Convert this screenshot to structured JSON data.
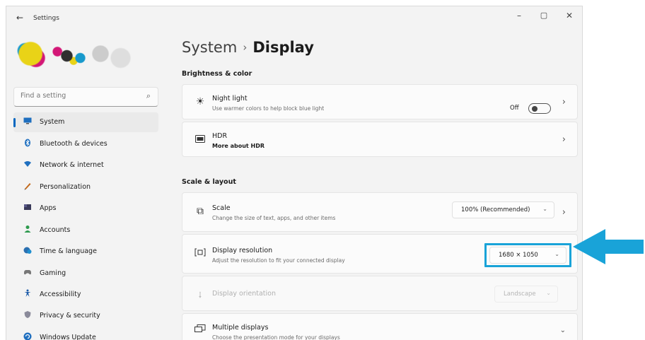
{
  "window": {
    "title": "Settings",
    "back": "←",
    "minimize": "–",
    "maximize": "▢",
    "close": "✕"
  },
  "sidebar": {
    "search": {
      "placeholder": "Find a setting",
      "icon": "search-icon"
    },
    "items": [
      {
        "label": "System",
        "icon": "monitor-icon",
        "selected": true
      },
      {
        "label": "Bluetooth & devices",
        "icon": "bluetooth-icon"
      },
      {
        "label": "Network & internet",
        "icon": "wifi-icon"
      },
      {
        "label": "Personalization",
        "icon": "pen-icon"
      },
      {
        "label": "Apps",
        "icon": "apps-icon"
      },
      {
        "label": "Accounts",
        "icon": "person-icon"
      },
      {
        "label": "Time & language",
        "icon": "globe-clock-icon"
      },
      {
        "label": "Gaming",
        "icon": "gamepad-icon"
      },
      {
        "label": "Accessibility",
        "icon": "accessibility-icon"
      },
      {
        "label": "Privacy & security",
        "icon": "shield-icon"
      },
      {
        "label": "Windows Update",
        "icon": "update-icon"
      }
    ]
  },
  "main": {
    "breadcrumb": {
      "parent": "System",
      "separator": "›",
      "current": "Display"
    },
    "sections": {
      "brightness": "Brightness & color",
      "scale_layout": "Scale & layout"
    },
    "night_light": {
      "title": "Night light",
      "description": "Use warmer colors to help block blue light",
      "state": "Off",
      "on": false
    },
    "hdr": {
      "title": "HDR",
      "link": "More about HDR"
    },
    "scale": {
      "title": "Scale",
      "description": "Change the size of text, apps, and other items",
      "value": "100% (Recommended)"
    },
    "resolution": {
      "title": "Display resolution",
      "description": "Adjust the resolution to fit your connected display",
      "value": "1680 × 1050"
    },
    "orientation": {
      "title": "Display orientation",
      "value": "Landscape"
    },
    "multiple_displays": {
      "title": "Multiple displays",
      "description": "Choose the presentation mode for your displays"
    }
  },
  "colors": {
    "accent": "#0067c0",
    "highlight": "#19a3d8",
    "arrow": "#19a3d8"
  }
}
